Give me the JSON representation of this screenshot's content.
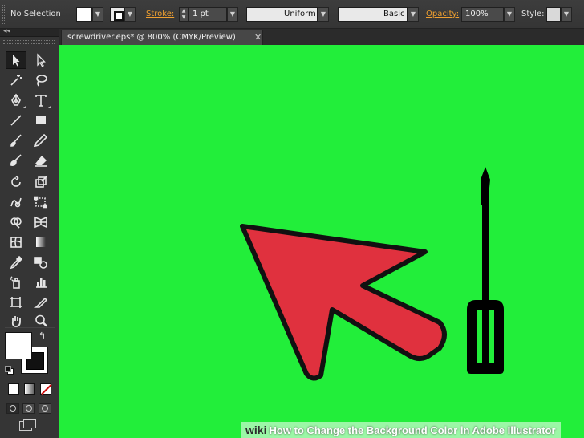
{
  "control_bar": {
    "selection_label": "No Selection",
    "stroke_label": "Stroke:",
    "stroke_weight": "1 pt",
    "variable_width_profile": "Uniform",
    "brush_definition": "Basic",
    "opacity_label": "Opacity:",
    "opacity_value": "100%",
    "style_label": "Style:",
    "fill_color": "#ffffff",
    "accent_color": "#f0a030"
  },
  "document": {
    "tab_title": "screwdriver.eps* @ 800% (CMYK/Preview)",
    "close_glyph": "✕",
    "artboard_background": "#22ee3a"
  },
  "tools": {
    "collapse_glyph": "◂◂",
    "swap_glyph": "↰",
    "items": [
      {
        "name": "selection-tool",
        "icon": "arrow-icon"
      },
      {
        "name": "direct-selection-tool",
        "icon": "hollow-arrow-icon"
      },
      {
        "name": "magic-wand-tool",
        "icon": "wand-icon"
      },
      {
        "name": "lasso-tool",
        "icon": "lasso-icon"
      },
      {
        "name": "pen-tool",
        "icon": "pen-icon"
      },
      {
        "name": "type-tool",
        "icon": "type-icon",
        "glyph": "T"
      },
      {
        "name": "line-tool",
        "icon": "line-icon"
      },
      {
        "name": "rectangle-tool",
        "icon": "rectangle-icon"
      },
      {
        "name": "paintbrush-tool",
        "icon": "brush-icon"
      },
      {
        "name": "pencil-tool",
        "icon": "pencil-icon"
      },
      {
        "name": "blob-brush-tool",
        "icon": "blob-brush-icon"
      },
      {
        "name": "eraser-tool",
        "icon": "eraser-icon"
      },
      {
        "name": "rotate-tool",
        "icon": "rotate-icon"
      },
      {
        "name": "scale-tool",
        "icon": "scale-icon"
      },
      {
        "name": "warp-tool",
        "icon": "warp-icon"
      },
      {
        "name": "free-transform-tool",
        "icon": "free-transform-icon"
      },
      {
        "name": "shape-builder-tool",
        "icon": "shape-builder-icon"
      },
      {
        "name": "perspective-grid-tool",
        "icon": "perspective-grid-icon"
      },
      {
        "name": "mesh-tool",
        "icon": "mesh-icon"
      },
      {
        "name": "gradient-tool",
        "icon": "gradient-icon"
      },
      {
        "name": "eyedropper-tool",
        "icon": "eyedropper-icon"
      },
      {
        "name": "blend-tool",
        "icon": "blend-icon"
      },
      {
        "name": "symbol-sprayer-tool",
        "icon": "symbol-sprayer-icon"
      },
      {
        "name": "column-graph-tool",
        "icon": "graph-icon"
      },
      {
        "name": "artboard-tool",
        "icon": "artboard-icon"
      },
      {
        "name": "slice-tool",
        "icon": "slice-icon"
      },
      {
        "name": "hand-tool",
        "icon": "hand-icon"
      },
      {
        "name": "zoom-tool",
        "icon": "zoom-icon"
      }
    ]
  },
  "artwork": {
    "arrow_fill": "#e0313e",
    "arrow_stroke": "#111111",
    "screwdriver_color": "#000000"
  },
  "watermark": {
    "brand": "wiki",
    "title": "How to Change the Background Color in Adobe Illustrator"
  }
}
